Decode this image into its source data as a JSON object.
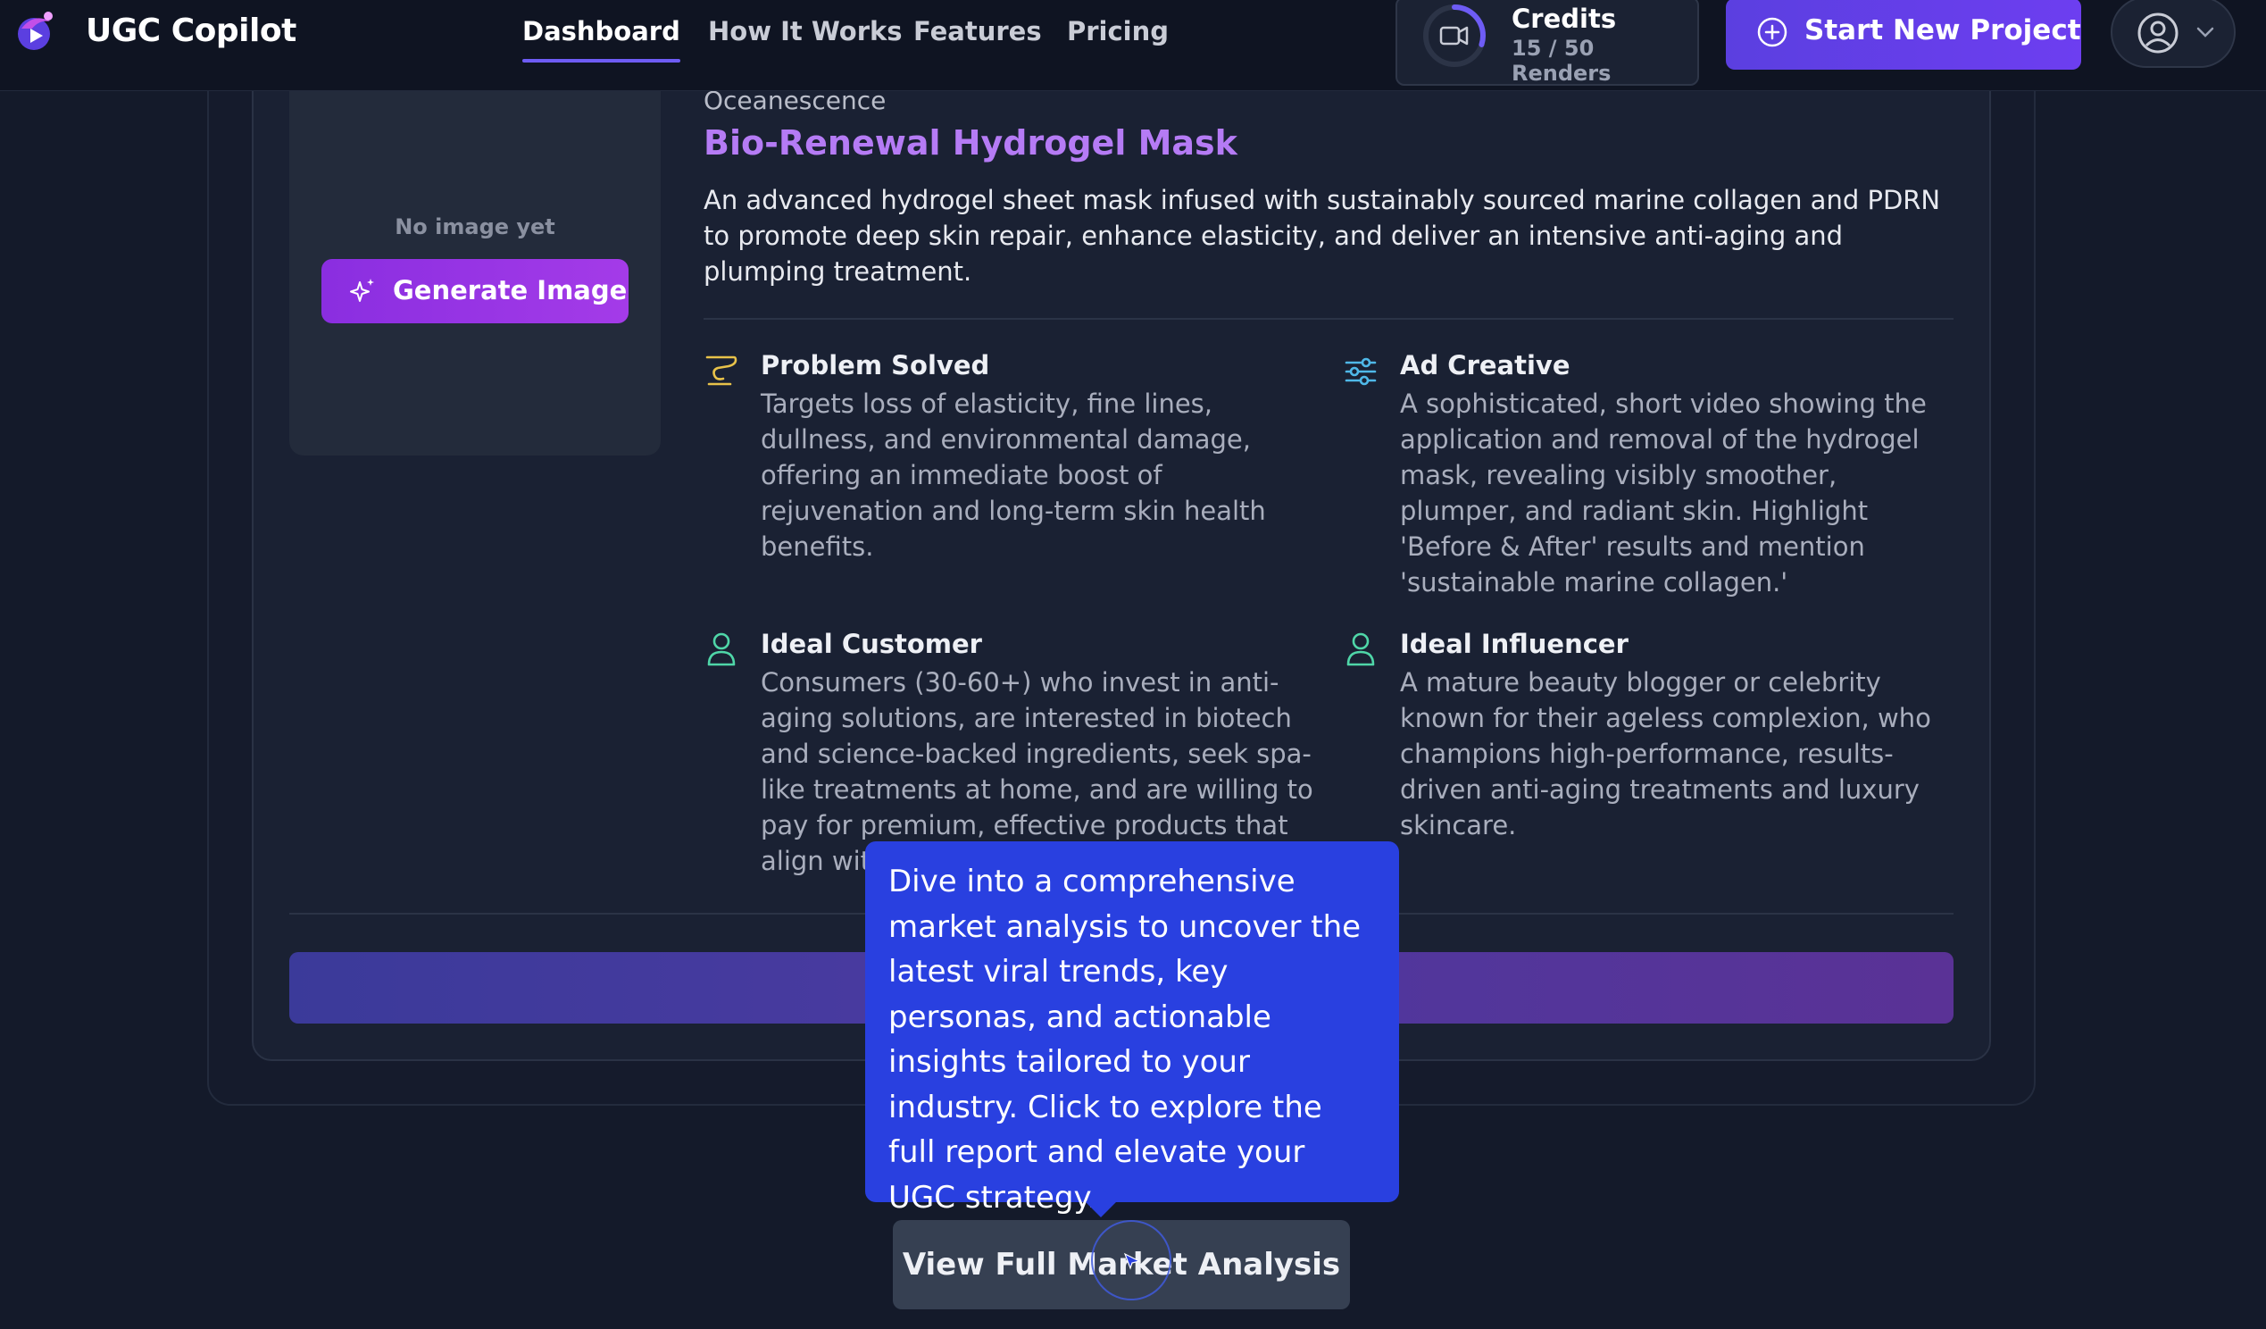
{
  "nav": {
    "brand": "UGC Copilot",
    "links": [
      {
        "label": "Dashboard",
        "active": true
      },
      {
        "label": "How It Works"
      },
      {
        "label": "Features"
      },
      {
        "label": "Pricing"
      }
    ],
    "credits": {
      "title": "Credits",
      "usage": "15 / 50 Renders",
      "fraction_used": 0.3
    },
    "start_button": "Start New Project",
    "accent": "#6e5cf5"
  },
  "product": {
    "image_placeholder": "No image yet",
    "generate_button": "Generate Image",
    "brand": "Oceanescence",
    "title": "Bio-Renewal Hydrogel Mask",
    "description": "An advanced hydrogel sheet mask infused with sustainably sourced marine collagen and PDRN to promote deep skin repair, enhance elasticity, and deliver an intensive anti-aging and plumping treatment.",
    "features": [
      {
        "icon": "pill-icon",
        "heading": "Problem Solved",
        "body": "Targets loss of elasticity, fine lines, dullness, and environmental damage, offering an immediate boost of rejuvenation and long-term skin health benefits."
      },
      {
        "icon": "sliders-icon",
        "heading": "Ad Creative",
        "body": "A sophisticated, short video showing the application and removal of the hydrogel mask, revealing visibly smoother, plumper, and radiant skin. Highlight 'Before & After' results and mention 'sustainable marine collagen.'"
      },
      {
        "icon": "user-icon",
        "heading": "Ideal Customer",
        "body": "Consumers (30-60+) who invest in anti-aging solutions, are interested in biotech and science-backed ingredients, seek spa-like treatments at home, and are willing to pay for premium, effective products that align wit"
      },
      {
        "icon": "user-icon",
        "heading": "Ideal Influencer",
        "body": "A mature beauty blogger or celebrity known for their ageless complexion, who champions high-performance, results-driven anti-aging treatments and luxury skincare."
      }
    ]
  },
  "tooltip": {
    "text": "Dive into a comprehensive market analysis to uncover the latest viral trends, key personas, and actionable insights tailored to your industry. Click to explore the full report and elevate your UGC strategy."
  },
  "market_button": "View Full Market Analysis"
}
